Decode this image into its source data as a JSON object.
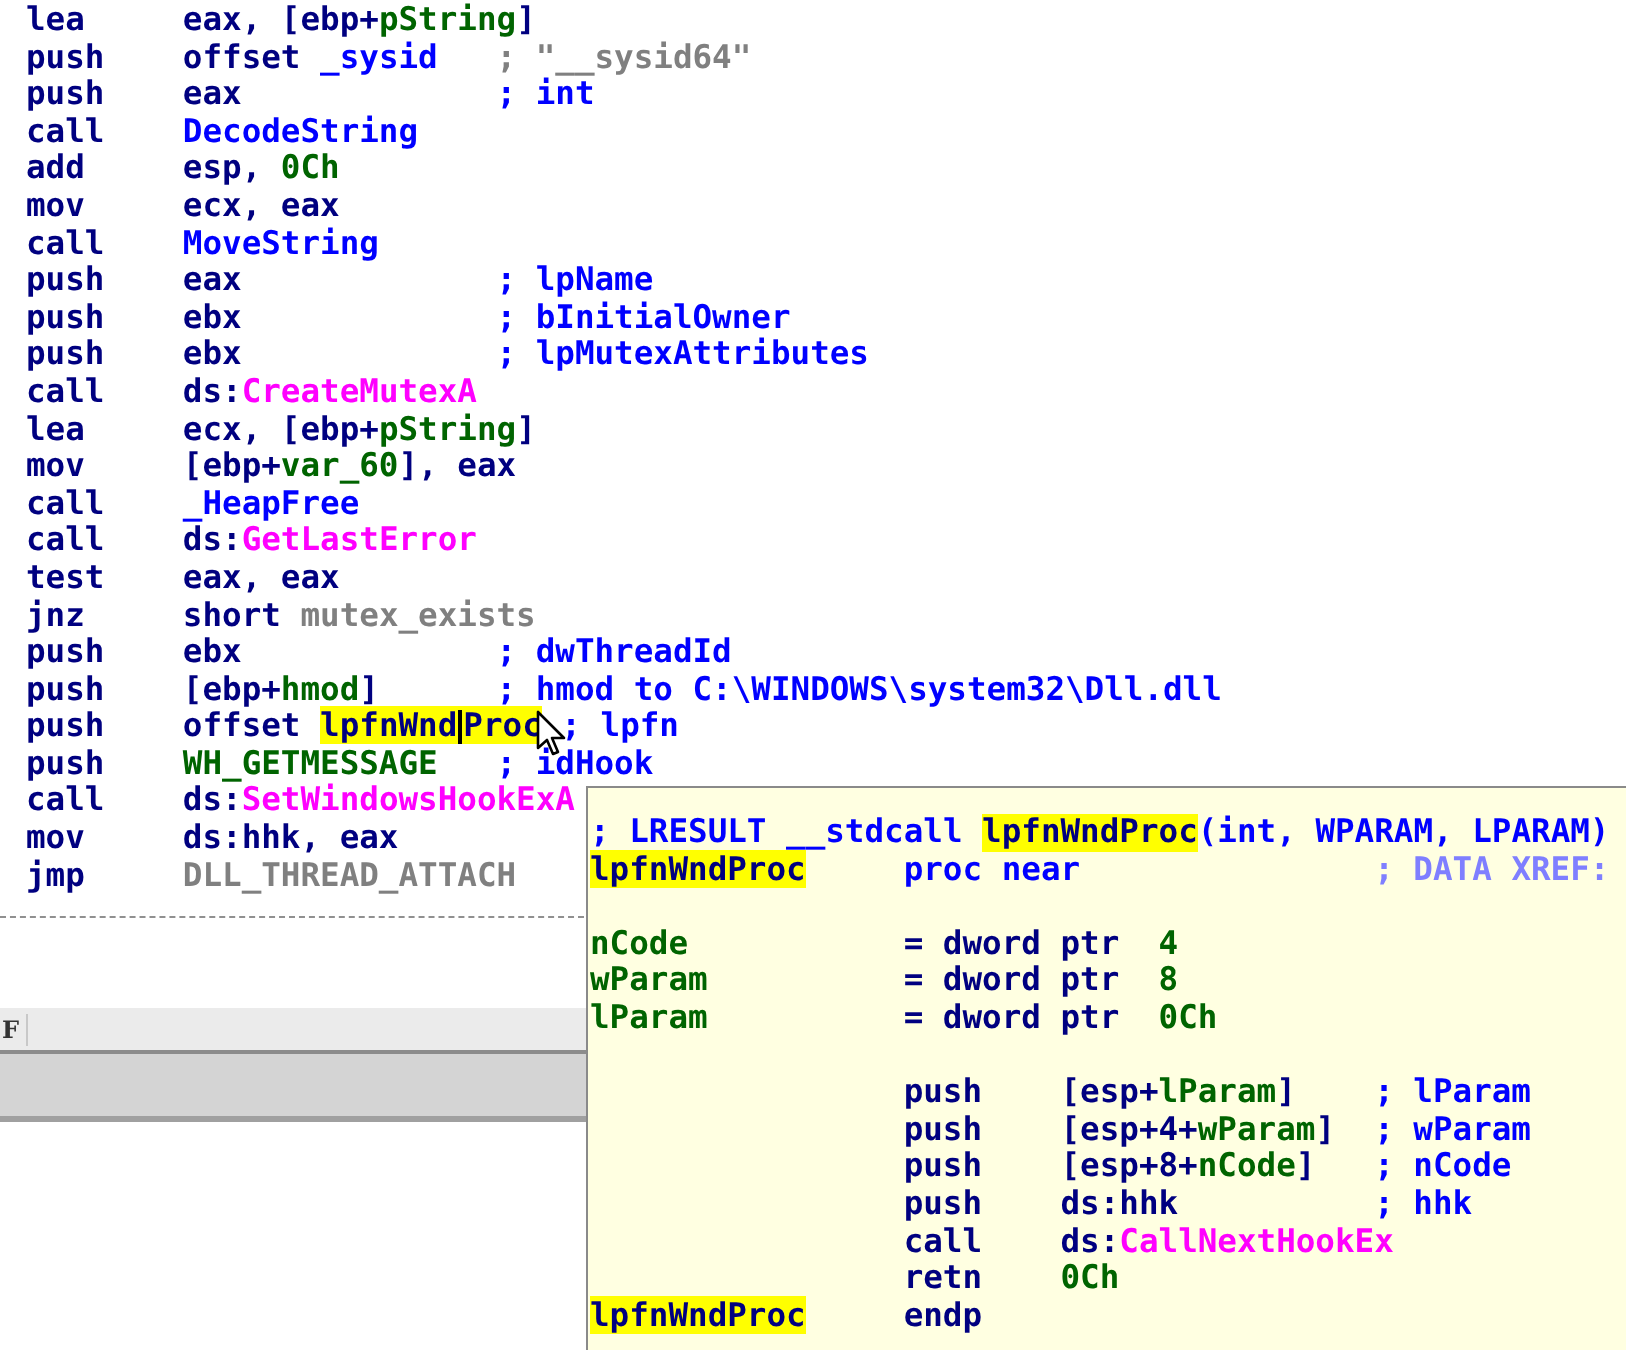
{
  "listing": {
    "lines": [
      {
        "mnemonic": "lea",
        "operand": [
          {
            "kind": "plain",
            "text": "eax, [ebp+"
          },
          {
            "kind": "var",
            "text": "pString"
          },
          {
            "kind": "plain",
            "text": "]"
          }
        ]
      },
      {
        "mnemonic": "push",
        "operand": [
          {
            "kind": "plain",
            "text": "offset "
          },
          {
            "kind": "name",
            "text": "_sysid"
          }
        ],
        "comment": [
          {
            "kind": "gray",
            "text": "; \"__sysid64\""
          }
        ]
      },
      {
        "mnemonic": "push",
        "operand": [
          {
            "kind": "plain",
            "text": "eax"
          }
        ],
        "comment": [
          {
            "kind": "comment",
            "text": "; int"
          }
        ]
      },
      {
        "mnemonic": "call",
        "operand": [
          {
            "kind": "name",
            "text": "DecodeString"
          }
        ]
      },
      {
        "mnemonic": "add",
        "operand": [
          {
            "kind": "plain",
            "text": "esp, "
          },
          {
            "kind": "var",
            "text": "0Ch"
          }
        ]
      },
      {
        "mnemonic": "mov",
        "operand": [
          {
            "kind": "plain",
            "text": "ecx, eax"
          }
        ]
      },
      {
        "mnemonic": "call",
        "operand": [
          {
            "kind": "name",
            "text": "MoveString"
          }
        ]
      },
      {
        "mnemonic": "push",
        "operand": [
          {
            "kind": "plain",
            "text": "eax"
          }
        ],
        "comment": [
          {
            "kind": "comment",
            "text": "; lpName"
          }
        ]
      },
      {
        "mnemonic": "push",
        "operand": [
          {
            "kind": "plain",
            "text": "ebx"
          }
        ],
        "comment": [
          {
            "kind": "comment",
            "text": "; bInitialOwner"
          }
        ]
      },
      {
        "mnemonic": "push",
        "operand": [
          {
            "kind": "plain",
            "text": "ebx"
          }
        ],
        "comment": [
          {
            "kind": "comment",
            "text": "; lpMutexAttributes"
          }
        ]
      },
      {
        "mnemonic": "call",
        "operand": [
          {
            "kind": "plain",
            "text": "ds:"
          },
          {
            "kind": "import",
            "text": "CreateMutexA"
          }
        ]
      },
      {
        "mnemonic": "lea",
        "operand": [
          {
            "kind": "plain",
            "text": "ecx, [ebp+"
          },
          {
            "kind": "var",
            "text": "pString"
          },
          {
            "kind": "plain",
            "text": "]"
          }
        ]
      },
      {
        "mnemonic": "mov",
        "operand": [
          {
            "kind": "plain",
            "text": "[ebp+"
          },
          {
            "kind": "var",
            "text": "var_60"
          },
          {
            "kind": "plain",
            "text": "], eax"
          }
        ]
      },
      {
        "mnemonic": "call",
        "operand": [
          {
            "kind": "name",
            "text": "_HeapFree"
          }
        ]
      },
      {
        "mnemonic": "call",
        "operand": [
          {
            "kind": "plain",
            "text": "ds:"
          },
          {
            "kind": "import",
            "text": "GetLastError"
          }
        ]
      },
      {
        "mnemonic": "test",
        "operand": [
          {
            "kind": "plain",
            "text": "eax, eax"
          }
        ]
      },
      {
        "mnemonic": "jnz",
        "operand": [
          {
            "kind": "plain",
            "text": "short "
          },
          {
            "kind": "gray",
            "text": "mutex_exists"
          }
        ]
      },
      {
        "mnemonic": "push",
        "operand": [
          {
            "kind": "plain",
            "text": "ebx"
          }
        ],
        "comment": [
          {
            "kind": "comment",
            "text": "; dwThreadId"
          }
        ]
      },
      {
        "mnemonic": "push",
        "operand": [
          {
            "kind": "plain",
            "text": "[ebp+"
          },
          {
            "kind": "var",
            "text": "hmod"
          },
          {
            "kind": "plain",
            "text": "]"
          }
        ],
        "comment": [
          {
            "kind": "comment",
            "text": "; hmod to C:\\WINDOWS\\system32\\Dll.dll"
          }
        ]
      },
      {
        "mnemonic": "push",
        "operand": [
          {
            "kind": "plain",
            "text": "offset "
          },
          {
            "kind": "plain",
            "text": "lpfnWnd",
            "highlighted": true
          },
          {
            "kind": "plain",
            "text": "Proc",
            "highlighted": true,
            "caret": true
          }
        ],
        "comment": [
          {
            "kind": "comment",
            "text": "; lpfn"
          }
        ]
      },
      {
        "mnemonic": "push",
        "operand": [
          {
            "kind": "var",
            "text": "WH_GETMESSAGE"
          }
        ],
        "comment": [
          {
            "kind": "comment",
            "text": "; idHook"
          }
        ]
      },
      {
        "mnemonic": "call",
        "operand": [
          {
            "kind": "plain",
            "text": "ds:"
          },
          {
            "kind": "import",
            "text": "SetWindowsHookExA"
          }
        ]
      },
      {
        "mnemonic": "mov",
        "operand": [
          {
            "kind": "plain",
            "text": "ds:hhk, eax"
          }
        ]
      },
      {
        "mnemonic": "jmp",
        "operand": [
          {
            "kind": "gray",
            "text": "DLL_THREAD_ATTACH"
          }
        ]
      }
    ]
  },
  "bottom_bar": {
    "label": "F"
  },
  "tooltip": {
    "blocks": [
      [
        {
          "kind": "header",
          "text": [
            {
              "kind": "comment",
              "text": "; LRESULT __stdcall "
            },
            {
              "kind": "plain",
              "text": "lpfnWndProc",
              "highlighted": true
            },
            {
              "kind": "comment",
              "text": "(int, WPARAM, LPARAM)"
            }
          ]
        },
        {
          "kind": "def",
          "label": {
            "kind": "plain",
            "text": "lpfnWndProc",
            "highlighted": true
          },
          "text": [
            {
              "kind": "comment",
              "text": "proc near"
            }
          ],
          "comment": [
            {
              "kind": "xref",
              "text": "; DATA XREF:"
            }
          ]
        }
      ],
      [
        {
          "kind": "def",
          "label": {
            "kind": "var",
            "text": "nCode"
          },
          "text": [
            {
              "kind": "plain",
              "text": "= dword ptr  "
            },
            {
              "kind": "var",
              "text": "4"
            }
          ]
        },
        {
          "kind": "def",
          "label": {
            "kind": "var",
            "text": "wParam"
          },
          "text": [
            {
              "kind": "plain",
              "text": "= dword ptr  "
            },
            {
              "kind": "var",
              "text": "8"
            }
          ]
        },
        {
          "kind": "def",
          "label": {
            "kind": "var",
            "text": "lParam"
          },
          "text": [
            {
              "kind": "plain",
              "text": "= dword ptr  "
            },
            {
              "kind": "var",
              "text": "0Ch"
            }
          ]
        }
      ],
      [
        {
          "kind": "instr",
          "mnemonic": "push",
          "operand": [
            {
              "kind": "plain",
              "text": "[esp+"
            },
            {
              "kind": "var",
              "text": "lParam"
            },
            {
              "kind": "plain",
              "text": "]"
            }
          ],
          "comment": [
            {
              "kind": "comment",
              "text": "; lParam"
            }
          ]
        },
        {
          "kind": "instr",
          "mnemonic": "push",
          "operand": [
            {
              "kind": "plain",
              "text": "[esp+4+"
            },
            {
              "kind": "var",
              "text": "wParam"
            },
            {
              "kind": "plain",
              "text": "]"
            }
          ],
          "comment": [
            {
              "kind": "comment",
              "text": "; wParam"
            }
          ]
        },
        {
          "kind": "instr",
          "mnemonic": "push",
          "operand": [
            {
              "kind": "plain",
              "text": "[esp+8+"
            },
            {
              "kind": "var",
              "text": "nCode"
            },
            {
              "kind": "plain",
              "text": "]"
            }
          ],
          "comment": [
            {
              "kind": "comment",
              "text": "; nCode"
            }
          ]
        },
        {
          "kind": "instr",
          "mnemonic": "push",
          "operand": [
            {
              "kind": "plain",
              "text": "ds:hhk"
            }
          ],
          "comment": [
            {
              "kind": "comment",
              "text": "; hhk"
            }
          ]
        },
        {
          "kind": "instr",
          "mnemonic": "call",
          "operand": [
            {
              "kind": "plain",
              "text": "ds:"
            },
            {
              "kind": "import",
              "text": "CallNextHookEx"
            }
          ]
        },
        {
          "kind": "instr",
          "mnemonic": "retn",
          "operand": [
            {
              "kind": "var",
              "text": "0Ch"
            }
          ]
        },
        {
          "kind": "instr",
          "label": {
            "kind": "plain",
            "text": "lpfnWndProc",
            "highlighted": true
          },
          "mnemonic": "endp"
        }
      ]
    ]
  }
}
